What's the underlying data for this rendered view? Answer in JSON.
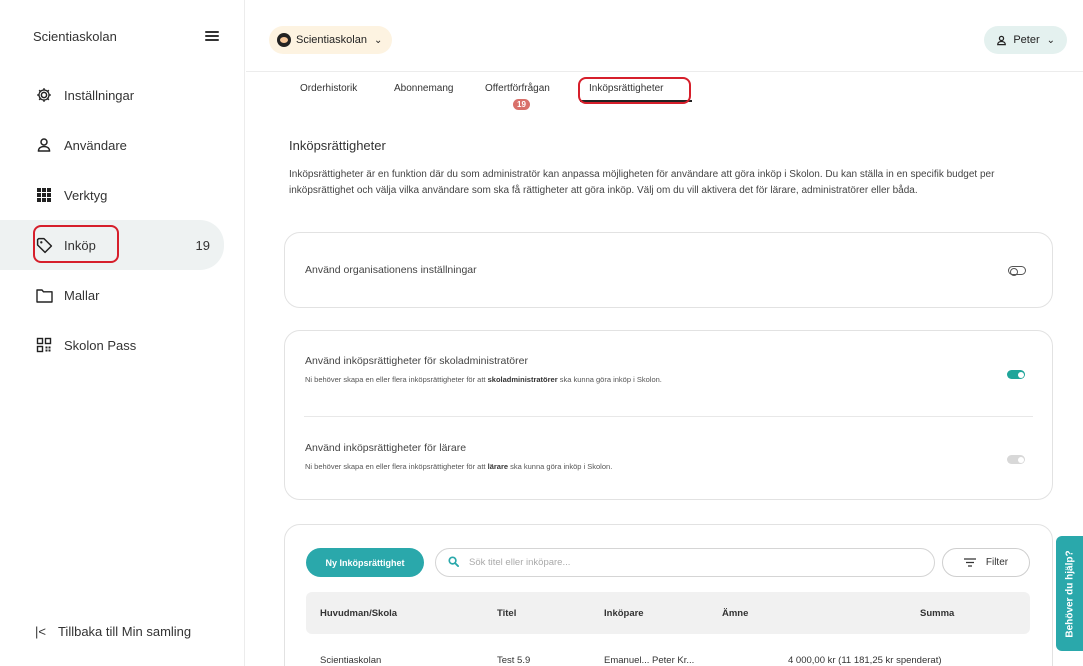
{
  "sidebar": {
    "brand": "Scientiaskolan",
    "items": [
      {
        "label": "Inställningar",
        "icon": "gear-icon"
      },
      {
        "label": "Användare",
        "icon": "user-icon"
      },
      {
        "label": "Verktyg",
        "icon": "grid-icon"
      },
      {
        "label": "Inköp",
        "icon": "tag-icon",
        "badge": "19"
      },
      {
        "label": "Mallar",
        "icon": "folder-icon"
      },
      {
        "label": "Skolon Pass",
        "icon": "qr-icon"
      }
    ],
    "footer": "Tillbaka till Min samling"
  },
  "topbar": {
    "org": "Scientiaskolan",
    "user": "Peter"
  },
  "tabs": {
    "items": [
      "Orderhistorik",
      "Abonnemang",
      "Offertförfrågan",
      "Inköpsrättigheter"
    ],
    "badge": "19",
    "active": "Inköpsrättigheter"
  },
  "main": {
    "title": "Inköpsrättigheter",
    "description": "Inköpsrättigheter är en funktion där du som administratör kan anpassa möjligheten för användare att göra inköp i Skolon. Du kan ställa in en specifik budget per inköpsrättighet och välja vilka användare som ska få rättigheter att göra inköp. Välj om du vill aktivera det för lärare, administratörer eller båda.",
    "org_settings_label": "Använd organisationens inställningar",
    "admin_label": "Använd inköpsrättigheter för skoladministratörer",
    "admin_sub_pre": "Ni behöver skapa en eller flera inköpsrättigheter för att ",
    "admin_sub_bold": "skoladministratörer",
    "admin_sub_post": " ska kunna göra inköp i Skolon.",
    "teacher_label": "Använd inköpsrättigheter för lärare",
    "teacher_sub_pre": "Ni behöver skapa en eller flera inköpsrättigheter för att ",
    "teacher_sub_bold": "lärare",
    "teacher_sub_post": " ska kunna göra inköp i Skolon."
  },
  "toggles": {
    "org_settings": "off",
    "admins": "on",
    "teachers": "disabled"
  },
  "table": {
    "new_button": "Ny Inköpsrättighet",
    "search_placeholder": "Sök titel eller inköpare...",
    "filter_label": "Filter",
    "headers": [
      "Huvudman/Skola",
      "Titel",
      "Inköpare",
      "Ämne",
      "Summa"
    ],
    "rows": [
      [
        "Scientiaskolan",
        "Test 5.9",
        "Emanuel... Peter Kr...",
        "",
        "4 000,00 kr (11 181,25 kr spenderat)"
      ]
    ]
  },
  "help": "Behöver du hjälp?",
  "colors": {
    "accent": "#2aa8ab",
    "highlight": "#d61f2b",
    "badge": "#d9706a"
  }
}
